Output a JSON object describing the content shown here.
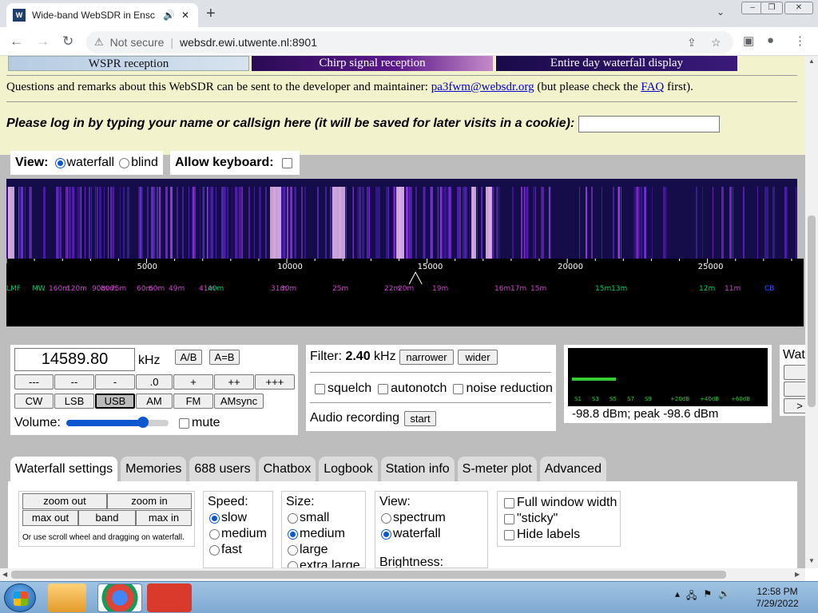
{
  "browser": {
    "tab_title": "Wide-band WebSDR in Ensc",
    "tab_favicon": "websdr-favicon",
    "new_tab": "+",
    "security_label": "Not secure",
    "url": "websdr.ewi.utwente.nl:8901"
  },
  "page": {
    "banners": [
      "WSPR reception",
      "Chirp signal reception",
      "Entire day waterfall display"
    ],
    "remarks_prefix": "Questions and remarks about this WebSDR can be sent to the developer and maintainer: ",
    "remarks_email": "pa3fwm@websdr.org",
    "remarks_mid": " (but please check the ",
    "remarks_faq": "FAQ",
    "remarks_suffix": " first).",
    "login_prompt": "Please log in by typing your name or callsign here (it will be saved for later visits in a cookie):",
    "login_value": "",
    "view_label": "View:",
    "view_waterfall": "waterfall",
    "view_blind": "blind",
    "allow_keyboard": "Allow keyboard:"
  },
  "scale": {
    "ticks": [
      "5000",
      "10000",
      "15000",
      "20000",
      "25000"
    ],
    "bands": [
      "LMF",
      "MW",
      "160m",
      "120m",
      "90m",
      "80m",
      "75m",
      "60m",
      "60m",
      "49m",
      "41m",
      "40m",
      "31m",
      "30m",
      "25m",
      "22m",
      "20m",
      "19m",
      "16m",
      "17m",
      "15m",
      "15m",
      "13m",
      "12m",
      "11m",
      "CB"
    ]
  },
  "receiver": {
    "frequency": "14589.80",
    "unit": "kHz",
    "ab": "A/B",
    "a_eq_b": "A=B",
    "steps": [
      "---",
      "--",
      "-",
      ".0",
      "+",
      "++",
      "+++"
    ],
    "modes": [
      "CW",
      "LSB",
      "USB",
      "AM",
      "FM",
      "AMsync"
    ],
    "selected_mode": "USB",
    "volume_label": "Volume:",
    "volume_level": 0.75,
    "mute_label": "mute"
  },
  "filter": {
    "label": "Filter:",
    "bandwidth": "2.40",
    "unit": "kHz",
    "narrower": "narrower",
    "wider": "wider",
    "squelch": "squelch",
    "autonotch": "autonotch",
    "noise_reduction": "noise reduction",
    "audio_recording": "Audio recording",
    "start": "start"
  },
  "smeter": {
    "scale_labels": [
      "S1",
      "S3",
      "S5",
      "S7",
      "S9",
      "+20dB",
      "+40dB",
      "+60dB"
    ],
    "level": 0.22,
    "readout": "-98.8 dBm; peak  -98.6 dBm"
  },
  "right_panel": {
    "title": "Wat",
    "btn3": ">"
  },
  "tabs": [
    "Waterfall settings",
    "Memories",
    "688 users",
    "Chatbox",
    "Logbook",
    "Station info",
    "S-meter plot",
    "Advanced"
  ],
  "waterfall_settings": {
    "zoom_out": "zoom out",
    "zoom_in": "zoom in",
    "max_out": "max out",
    "band": "band",
    "max_in": "max in",
    "hint": "Or use scroll wheel and dragging on waterfall.",
    "speed_label": "Speed:",
    "speed_options": [
      "slow",
      "medium",
      "fast"
    ],
    "size_label": "Size:",
    "size_options": [
      "small",
      "medium",
      "large",
      "extra large"
    ],
    "view_label": "View:",
    "view_options": [
      "spectrum",
      "waterfall"
    ],
    "brightness_label": "Brightness:",
    "full_width": "Full window width",
    "sticky": "\"sticky\"",
    "hide_labels": "Hide labels"
  },
  "taskbar": {
    "time": "12:58 PM",
    "date": "7/29/2022"
  },
  "colors": {
    "accent": "#0b57d0",
    "page_bg": "#bdbdbd",
    "meter_green": "#33cc33",
    "link": "#0000cc"
  }
}
